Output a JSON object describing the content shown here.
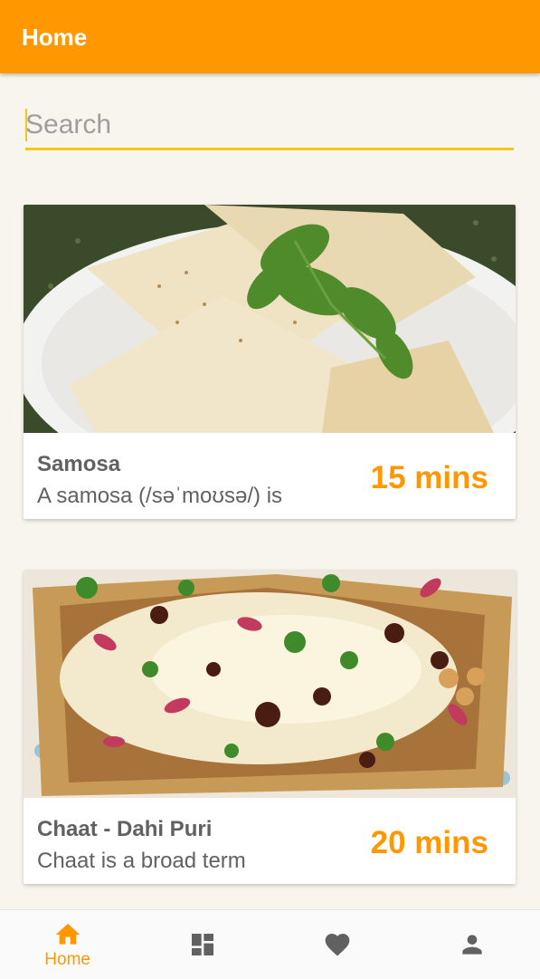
{
  "appbar": {
    "title": "Home"
  },
  "search": {
    "placeholder": "Search",
    "value": ""
  },
  "recipes": [
    {
      "title": "Samosa",
      "description": "A samosa (/səˈmoʊsə/) is",
      "time": "15 mins",
      "image": "samosa-photo"
    },
    {
      "title": "Chaat - Dahi Puri",
      "description": "Chaat is a broad term",
      "time": "20 mins",
      "image": "chaat-photo"
    }
  ],
  "bottom_nav": {
    "items": [
      {
        "icon": "home-icon",
        "label": "Home",
        "active": true
      },
      {
        "icon": "dashboard-icon",
        "label": "",
        "active": false
      },
      {
        "icon": "heart-icon",
        "label": "",
        "active": false
      },
      {
        "icon": "person-icon",
        "label": "",
        "active": false
      }
    ]
  },
  "colors": {
    "primary": "#ff9800",
    "accent": "#f5c518",
    "background": "#f8f5ee",
    "inactive_icon": "#616161"
  }
}
